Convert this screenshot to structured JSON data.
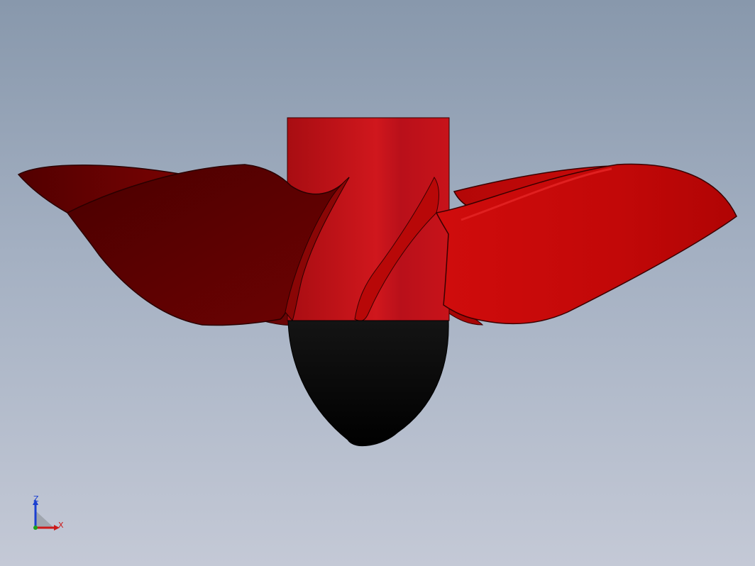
{
  "viewport": {
    "background_top": "#8898ac",
    "background_bottom": "#c4c9d6"
  },
  "model": {
    "name": "propeller",
    "blade_count": 4,
    "hub_color": "#c0151a",
    "blade_color_light": "#c40a0a",
    "blade_color_dark": "#5c0000",
    "spinner_color": "#000000"
  },
  "triad": {
    "z_label": "Z",
    "x_label": "X",
    "z_color": "#1a3fd1",
    "x_color": "#cc1a1a",
    "origin_color": "#1aa31a"
  }
}
